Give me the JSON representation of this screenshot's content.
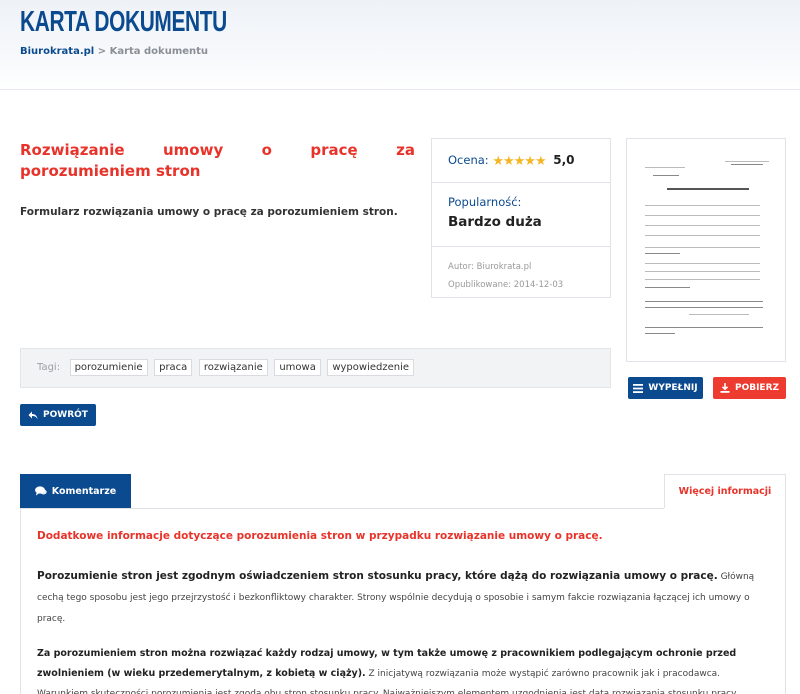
{
  "header": {
    "title": "KARTA DOKUMENTU",
    "breadcrumb_home": "Biurokrata.pl",
    "breadcrumb_sep": ">",
    "breadcrumb_current": "Karta dokumentu"
  },
  "document": {
    "title": "Rozwiązanie umowy o pracę za porozumieniem stron",
    "description": "Formularz rozwiązania umowy o pracę za porozumieniem stron."
  },
  "info": {
    "rating_label": "Ocena:",
    "rating_stars": "★★★★★",
    "rating_value": "5,0",
    "popularity_label": "Popularność:",
    "popularity_value": "Bardzo duża",
    "author": "Autor: Biurokrata.pl",
    "published": "Opublikowane: 2014-12-03"
  },
  "tags": {
    "label": "Tagi:",
    "items": [
      "porozumienie",
      "praca",
      "rozwiązanie",
      "umowa",
      "wypowiedzenie"
    ]
  },
  "buttons": {
    "fill": "WYPEŁNIJ",
    "download": "POBIERZ",
    "back": "POWRÓT"
  },
  "tabs": {
    "comments": "Komentarze",
    "more_info": "Więcej informacji"
  },
  "content": {
    "heading": "Dodatkowe informacje dotyczące porozumienia stron w przypadku rozwiązanie umowy o pracę.",
    "p1_bold": "Porozumienie stron jest zgodnym oświadczeniem stron stosunku pracy, które dążą do rozwiązania umowy o pracę.",
    "p1_text": " Główną cechą tego sposobu jest jego przejrzystość i bezkonfliktowy charakter. Strony wspólnie decydują o sposobie i samym fakcie rozwiązania łączącej ich umowy o pracę.",
    "p2_bold": "Za porozumieniem stron można rozwiązać każdy rodzaj umowy, w tym także umowę z pracownikiem podlegającym ochronie przed zwolnieniem (w wieku przedemerytalnym, z kobietą w ciąży).",
    "p2_text": " Z inicjatywą rozwiązania może wystąpić zarówno pracownik jak i pracodawca. Warunkiem skuteczności porozumienia jest zgoda obu stron stosunku pracy. Najważniejszym elementem uzgodnienia jest data rozwiązania stosunku pracy."
  },
  "icons": {
    "star": "star-icon",
    "menu": "menu-icon",
    "download": "download-icon",
    "back": "reply-arrow-icon",
    "comments": "comments-icon"
  },
  "colors": {
    "primary": "#0b4a8f",
    "accent": "#e8332a",
    "download": "#ed3b2f",
    "star": "#f5b623"
  }
}
